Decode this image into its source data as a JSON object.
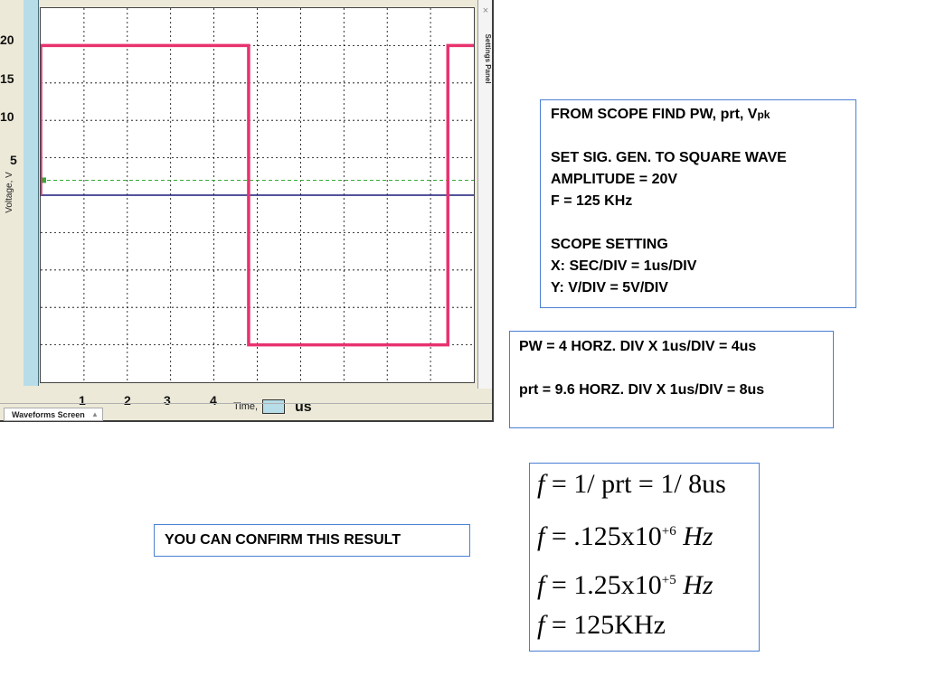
{
  "scope": {
    "y_axis_label": "Voltage, V",
    "y_ticks": [
      "20",
      "15",
      "10",
      "5"
    ],
    "x_ticks": [
      "1",
      "2",
      "3",
      "4"
    ],
    "time_label": "Time,",
    "time_unit": "us",
    "settings_panel_label": "Settings Panel",
    "close_glyph": "×",
    "waveforms_tab": "Waveforms Screen",
    "tab_arrow": "▲",
    "colors": {
      "square_wave": "#e8336f",
      "baseline_trace": "#1a1a7a",
      "trigger_level": "#33aa33",
      "grid": "#000000"
    },
    "chart_data": {
      "type": "line",
      "x_divisions": 10,
      "y_divisions": 10,
      "grid": true,
      "series": [
        {
          "x": [
            0,
            0,
            4.8,
            4.8,
            9.4,
            9.4,
            10
          ],
          "y": [
            0,
            20,
            20,
            -20,
            -20,
            20,
            20
          ]
        },
        {
          "x": [
            0,
            10
          ],
          "y": [
            0,
            0
          ]
        }
      ],
      "trigger_level": 2,
      "ylim": [
        -25,
        25
      ],
      "xlim": [
        0,
        10
      ]
    }
  },
  "instructions": {
    "line1_main": "FROM SCOPE FIND PW, prt, V",
    "line1_sub": "pk",
    "line2": "SET SIG. GEN. TO SQUARE WAVE",
    "line3": "AMPLITUDE = 20V",
    "line4": "F = 125 KHz",
    "line5": "SCOPE SETTING",
    "line6": "X: SEC/DIV = 1us/DIV",
    "line7": "Y: V/DIV = 5V/DIV"
  },
  "results": {
    "pw": "PW = 4 HORZ. DIV X 1us/DIV = 4us",
    "prt": "prt = 9.6 HORZ. DIV X 1us/DIV = 8us"
  },
  "confirm": "YOU CAN CONFIRM THIS RESULT",
  "equations": {
    "eq1": {
      "lhs": "f",
      "rhs": "= 1/ prt = 1/ 8us"
    },
    "eq2": {
      "lhs": "f",
      "pre": "= .125x10",
      "exp": "+6",
      "unit": " Hz"
    },
    "eq3": {
      "lhs": "f",
      "pre": "= 1.25x10",
      "exp": "+5",
      "unit": " Hz"
    },
    "eq4": {
      "lhs": "f",
      "rhs": "= 125KHz"
    }
  }
}
